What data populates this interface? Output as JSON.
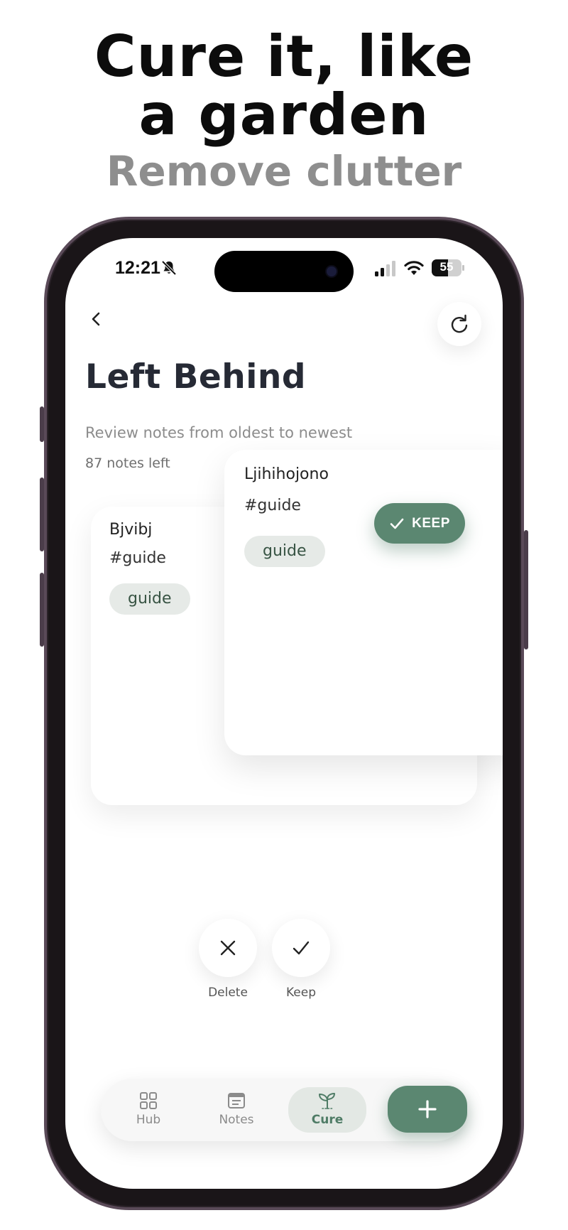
{
  "promo": {
    "headline_line1": "Cure it, like",
    "headline_line2": "a garden",
    "subheadline": "Remove clutter"
  },
  "status_bar": {
    "time": "12:21",
    "battery": "55",
    "battery_level": 0.55,
    "icons": [
      "bell-slash-icon",
      "signal-icon",
      "wifi-icon",
      "battery-icon"
    ]
  },
  "header": {
    "back_icon": "chevron-left-icon",
    "refresh_icon": "refresh-icon",
    "title": "Left Behind",
    "subtitle": "Review notes from oldest to newest",
    "notes_left": "87 notes left"
  },
  "cards": [
    {
      "title": "Ljihihojono",
      "hashtag": "#guide",
      "chip": "guide"
    },
    {
      "title": "Bjvibj",
      "hashtag": "#guide",
      "chip": "guide"
    }
  ],
  "swipe_stamp": {
    "label": "KEEP",
    "icon": "check-icon"
  },
  "actions": {
    "delete_label": "Delete",
    "keep_label": "Keep"
  },
  "tabbar": {
    "tabs": [
      {
        "label": "Hub",
        "icon": "grid-icon",
        "active": false
      },
      {
        "label": "Notes",
        "icon": "notes-icon",
        "active": false
      },
      {
        "label": "Cure",
        "icon": "sprout-icon",
        "active": true
      }
    ],
    "add_icon": "plus-icon"
  },
  "colors": {
    "accent": "#5b8771",
    "chip_bg": "#e6eae7",
    "title": "#262a35",
    "muted": "#8c8c8c"
  }
}
